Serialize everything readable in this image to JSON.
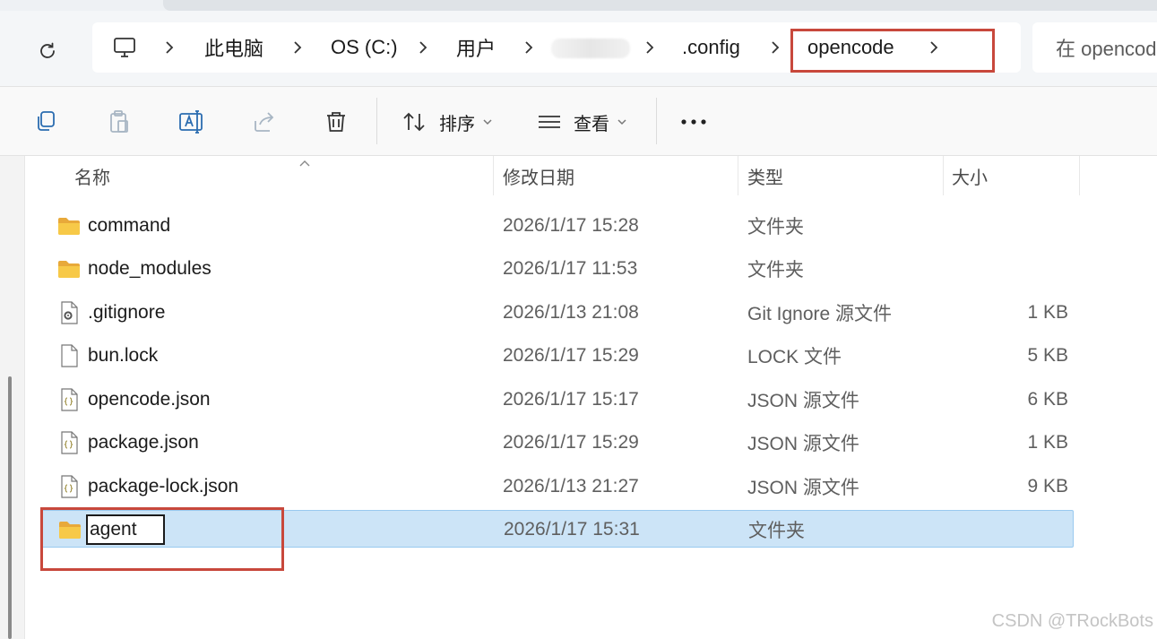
{
  "address_bar": {
    "breadcrumb": {
      "this_pc": "此电脑",
      "drive": "OS (C:)",
      "users": "用户",
      "config": ".config",
      "current": "opencode"
    },
    "search_placeholder": "在 opencode 中搜索"
  },
  "toolbar": {
    "sort_label": "排序",
    "view_label": "查看",
    "more_label": "..."
  },
  "columns": {
    "name": "名称",
    "modified": "修改日期",
    "type": "类型",
    "size": "大小"
  },
  "files": [
    {
      "name": "command",
      "date": "2026/1/17 15:28",
      "type": "文件夹",
      "size": "",
      "icon": "folder-icon"
    },
    {
      "name": "node_modules",
      "date": "2026/1/17 11:53",
      "type": "文件夹",
      "size": "",
      "icon": "folder-icon"
    },
    {
      "name": ".gitignore",
      "date": "2026/1/13 21:08",
      "type": "Git Ignore 源文件",
      "size": "1 KB",
      "icon": "settings-file-icon"
    },
    {
      "name": "bun.lock",
      "date": "2026/1/17 15:29",
      "type": "LOCK 文件",
      "size": "5 KB",
      "icon": "file-icon"
    },
    {
      "name": "opencode.json",
      "date": "2026/1/17 15:17",
      "type": "JSON 源文件",
      "size": "6 KB",
      "icon": "json-file-icon"
    },
    {
      "name": "package.json",
      "date": "2026/1/17 15:29",
      "type": "JSON 源文件",
      "size": "1 KB",
      "icon": "json-file-icon"
    },
    {
      "name": "package-lock.json",
      "date": "2026/1/13 21:27",
      "type": "JSON 源文件",
      "size": "9 KB",
      "icon": "json-file-icon"
    },
    {
      "name": "agent",
      "date": "2026/1/17 15:31",
      "type": "文件夹",
      "size": "",
      "icon": "folder-icon",
      "selected": true,
      "renaming": true
    }
  ],
  "watermark": "CSDN @TRockBots",
  "colors": {
    "selection": "#cce4f7",
    "selection_border": "#99c9ef",
    "annotation_red": "#c8483c",
    "folder_yellow": "#f7c948"
  }
}
